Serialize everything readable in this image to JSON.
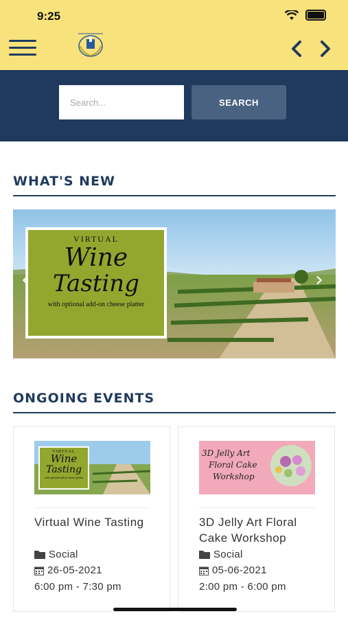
{
  "status_bar": {
    "time": "9:25"
  },
  "search": {
    "placeholder": "Search...",
    "value": "",
    "button_label": "SEARCH"
  },
  "whats_new": {
    "title": "WHAT'S NEW",
    "slide": {
      "line1": "VIRTUAL",
      "line2": "Wine",
      "line3": "Tasting",
      "line4": "with optional add-on cheese platter"
    }
  },
  "ongoing": {
    "title": "ONGOING EVENTS",
    "events": [
      {
        "title": "Virtual Wine Tasting",
        "category": "Social",
        "date": "26-05-2021",
        "time": "6:00 pm - 7:30 pm",
        "thumb": {
          "line1": "VIRTUAL",
          "line2": "Wine",
          "line3": "Tasting",
          "line4": "with optional add-on cheese platter"
        }
      },
      {
        "title": "3D Jelly Art Floral Cake Workshop",
        "category": "Social",
        "date": "05-06-2021",
        "time": "2:00 pm - 6:00 pm",
        "thumb": {
          "line1": "3D Jelly Art",
          "line2": "Floral Cake",
          "line3": "Workshop"
        }
      }
    ]
  },
  "colors": {
    "topbar": "#f8e27c",
    "navy": "#1f3a5c",
    "search_button": "#4a6282",
    "promo_green": "#93a72f"
  }
}
